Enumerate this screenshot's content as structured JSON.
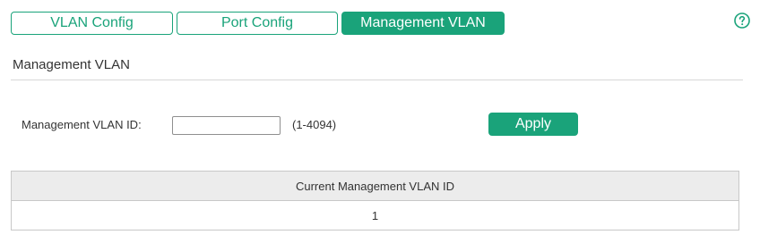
{
  "tabs": [
    {
      "label": "VLAN Config",
      "active": false
    },
    {
      "label": "Port Config",
      "active": false
    },
    {
      "label": "Management VLAN",
      "active": true
    }
  ],
  "help": {
    "icon": "help-circle-icon"
  },
  "section": {
    "title": "Management VLAN"
  },
  "form": {
    "label": "Management VLAN ID:",
    "input_value": "",
    "input_placeholder": "",
    "range_hint": "(1-4094)",
    "apply_label": "Apply"
  },
  "table": {
    "header": "Current Management VLAN ID",
    "rows": [
      {
        "value": "1"
      }
    ]
  },
  "colors": {
    "accent": "#1aa37a",
    "header_bg": "#ececec",
    "border": "#c8c8c8"
  }
}
